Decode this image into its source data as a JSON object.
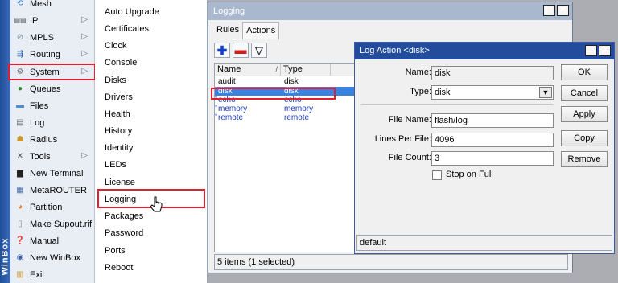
{
  "sidebar": {
    "brand": "WinBox",
    "items": [
      {
        "label": "Mesh",
        "icon": "mesh-icon",
        "arrow": false
      },
      {
        "label": "IP",
        "icon": "ip-icon",
        "arrow": true
      },
      {
        "label": "MPLS",
        "icon": "mpls-icon",
        "arrow": true
      },
      {
        "label": "Routing",
        "icon": "routing-icon",
        "arrow": true
      },
      {
        "label": "System",
        "icon": "gear-icon",
        "arrow": true
      },
      {
        "label": "Queues",
        "icon": "queues-icon",
        "arrow": false
      },
      {
        "label": "Files",
        "icon": "folder-icon",
        "arrow": false
      },
      {
        "label": "Log",
        "icon": "log-icon",
        "arrow": false
      },
      {
        "label": "Radius",
        "icon": "radius-icon",
        "arrow": false
      },
      {
        "label": "Tools",
        "icon": "tools-icon",
        "arrow": true
      },
      {
        "label": "New Terminal",
        "icon": "terminal-icon",
        "arrow": false
      },
      {
        "label": "MetaROUTER",
        "icon": "metarouter-icon",
        "arrow": false
      },
      {
        "label": "Partition",
        "icon": "partition-icon",
        "arrow": false
      },
      {
        "label": "Make Supout.rif",
        "icon": "document-icon",
        "arrow": false
      },
      {
        "label": "Manual",
        "icon": "help-icon",
        "arrow": false
      },
      {
        "label": "New WinBox",
        "icon": "winbox-icon",
        "arrow": false
      },
      {
        "label": "Exit",
        "icon": "exit-icon",
        "arrow": false
      }
    ]
  },
  "submenu": {
    "items": [
      "Auto Upgrade",
      "Certificates",
      "Clock",
      "Console",
      "Disks",
      "Drivers",
      "Health",
      "History",
      "Identity",
      "LEDs",
      "License",
      "Logging",
      "Packages",
      "Password",
      "Ports",
      "Reboot"
    ]
  },
  "logging": {
    "title": "Logging",
    "tabs": [
      "Rules",
      "Actions"
    ],
    "columns": [
      "Name",
      "Type"
    ],
    "rows": [
      {
        "name": "audit",
        "type": "disk",
        "dynamic": false,
        "selected": false
      },
      {
        "name": "disk",
        "type": "disk",
        "dynamic": true,
        "selected": true
      },
      {
        "name": "echo",
        "type": "echo",
        "dynamic": true,
        "selected": false
      },
      {
        "name": "memory",
        "type": "memory",
        "dynamic": true,
        "selected": false
      },
      {
        "name": "remote",
        "type": "remote",
        "dynamic": true,
        "selected": false
      }
    ],
    "status": "5 items (1 selected)"
  },
  "log_action": {
    "title": "Log Action <disk>",
    "name_label": "Name:",
    "name_value": "disk",
    "type_label": "Type:",
    "type_value": "disk",
    "file_name_label": "File Name:",
    "file_name_value": "flash/log",
    "lines_label": "Lines Per File:",
    "lines_value": "4096",
    "count_label": "File Count:",
    "count_value": "3",
    "stop_label": "Stop on Full",
    "buttons": [
      "OK",
      "Cancel",
      "Apply",
      "Copy",
      "Remove"
    ],
    "status": "default"
  },
  "colors": {
    "highlight_box": "#e02030",
    "selected_row": "#3a82e0",
    "dynamic_text": "#1a3bbf",
    "dialog_title": "#234c9c",
    "inactive_title": "#a9b8cc"
  }
}
